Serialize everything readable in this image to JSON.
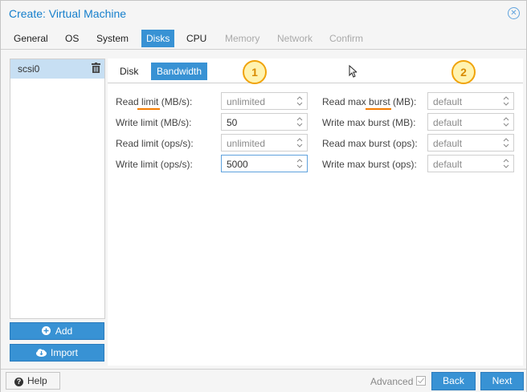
{
  "window": {
    "title": "Create: Virtual Machine"
  },
  "tabs": [
    {
      "label": "General"
    },
    {
      "label": "OS"
    },
    {
      "label": "System"
    },
    {
      "label": "Disks"
    },
    {
      "label": "CPU"
    },
    {
      "label": "Memory"
    },
    {
      "label": "Network"
    },
    {
      "label": "Confirm"
    }
  ],
  "disk_list": {
    "items": [
      {
        "label": "scsi0"
      }
    ]
  },
  "left_buttons": {
    "add": "Add",
    "import": "Import"
  },
  "subtabs": [
    {
      "label": "Disk"
    },
    {
      "label": "Bandwidth"
    }
  ],
  "badges": {
    "one": "1",
    "two": "2"
  },
  "fields_left": [
    {
      "label_pre": "Read ",
      "label_em": "limit",
      "label_post": " (MB/s):",
      "value": "unlimited",
      "placeholder": true
    },
    {
      "label_pre": "Write limit (MB/s):",
      "label_em": "",
      "label_post": "",
      "value": "50",
      "placeholder": false
    },
    {
      "label_pre": "Read limit (ops/s):",
      "label_em": "",
      "label_post": "",
      "value": "unlimited",
      "placeholder": true
    },
    {
      "label_pre": "Write limit (ops/s):",
      "label_em": "",
      "label_post": "",
      "value": "5000",
      "placeholder": false
    }
  ],
  "fields_right": [
    {
      "label_pre": "Read max ",
      "label_em": "burst",
      "label_post": " (MB):",
      "value": "default",
      "placeholder": true
    },
    {
      "label_pre": "Write max burst (MB):",
      "label_em": "",
      "label_post": "",
      "value": "default",
      "placeholder": true
    },
    {
      "label_pre": "Read max burst (ops):",
      "label_em": "",
      "label_post": "",
      "value": "default",
      "placeholder": true
    },
    {
      "label_pre": "Write max burst (ops):",
      "label_em": "",
      "label_post": "",
      "value": "default",
      "placeholder": true
    }
  ],
  "footer": {
    "help": "Help",
    "advanced": "Advanced",
    "back": "Back",
    "next": "Next"
  },
  "colors": {
    "accent": "#3892d4",
    "title": "#157fcc",
    "highlight_underline": "#f57c00",
    "badge_border": "#f0a30a"
  },
  "icons": {
    "close": "close-circle-icon",
    "trash": "trash-icon",
    "add": "plus-circle-icon",
    "import": "cloud-download-icon",
    "help": "question-circle-icon",
    "spinner": "spinner-arrows-icon",
    "cursor": "mouse-pointer-icon"
  }
}
